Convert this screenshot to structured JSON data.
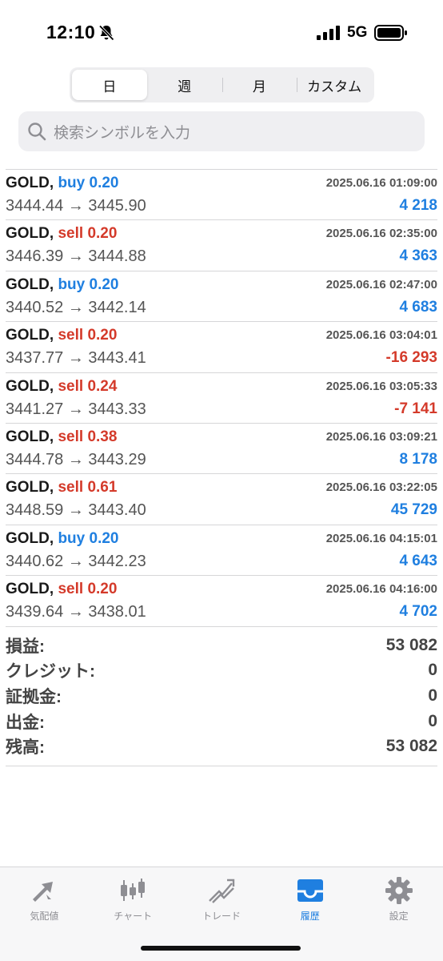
{
  "status_bar": {
    "time": "12:10",
    "network": "5G"
  },
  "segments": [
    {
      "label": "日",
      "active": true
    },
    {
      "label": "週",
      "active": false
    },
    {
      "label": "月",
      "active": false
    },
    {
      "label": "カスタム",
      "active": false
    }
  ],
  "search": {
    "placeholder": "検索シンボルを入力"
  },
  "trades": [
    {
      "symbol": "GOLD,",
      "side": "buy",
      "volume": "0.20",
      "time": "2025.06.16 01:09:00",
      "open": "3444.44",
      "close": "3445.90",
      "profit": "4 218"
    },
    {
      "symbol": "GOLD,",
      "side": "sell",
      "volume": "0.20",
      "time": "2025.06.16 02:35:00",
      "open": "3446.39",
      "close": "3444.88",
      "profit": "4 363"
    },
    {
      "symbol": "GOLD,",
      "side": "buy",
      "volume": "0.20",
      "time": "2025.06.16 02:47:00",
      "open": "3440.52",
      "close": "3442.14",
      "profit": "4 683"
    },
    {
      "symbol": "GOLD,",
      "side": "sell",
      "volume": "0.20",
      "time": "2025.06.16 03:04:01",
      "open": "3437.77",
      "close": "3443.41",
      "profit": "-16 293"
    },
    {
      "symbol": "GOLD,",
      "side": "sell",
      "volume": "0.24",
      "time": "2025.06.16 03:05:33",
      "open": "3441.27",
      "close": "3443.33",
      "profit": "-7 141"
    },
    {
      "symbol": "GOLD,",
      "side": "sell",
      "volume": "0.38",
      "time": "2025.06.16 03:09:21",
      "open": "3444.78",
      "close": "3443.29",
      "profit": "8 178"
    },
    {
      "symbol": "GOLD,",
      "side": "sell",
      "volume": "0.61",
      "time": "2025.06.16 03:22:05",
      "open": "3448.59",
      "close": "3443.40",
      "profit": "45 729"
    },
    {
      "symbol": "GOLD,",
      "side": "buy",
      "volume": "0.20",
      "time": "2025.06.16 04:15:01",
      "open": "3440.62",
      "close": "3442.23",
      "profit": "4 643"
    },
    {
      "symbol": "GOLD,",
      "side": "sell",
      "volume": "0.20",
      "time": "2025.06.16 04:16:00",
      "open": "3439.64",
      "close": "3438.01",
      "profit": "4 702"
    }
  ],
  "summary": [
    {
      "label": "損益:",
      "value": "53 082"
    },
    {
      "label": "クレジット:",
      "value": "0"
    },
    {
      "label": "証拠金:",
      "value": "0"
    },
    {
      "label": "出金:",
      "value": "0"
    },
    {
      "label": "残高:",
      "value": "53 082"
    }
  ],
  "tabs": [
    {
      "label": "気配値",
      "icon": "quotes-icon",
      "active": false
    },
    {
      "label": "チャート",
      "icon": "candlestick-chart-icon",
      "active": false
    },
    {
      "label": "トレード",
      "icon": "trade-trend-icon",
      "active": false
    },
    {
      "label": "履歴",
      "icon": "history-inbox-icon",
      "active": true
    },
    {
      "label": "設定",
      "icon": "gear-icon",
      "active": false
    }
  ],
  "colors": {
    "accent": "#1f7fe0",
    "loss": "#d43a2a",
    "text_gray": "#555555"
  }
}
